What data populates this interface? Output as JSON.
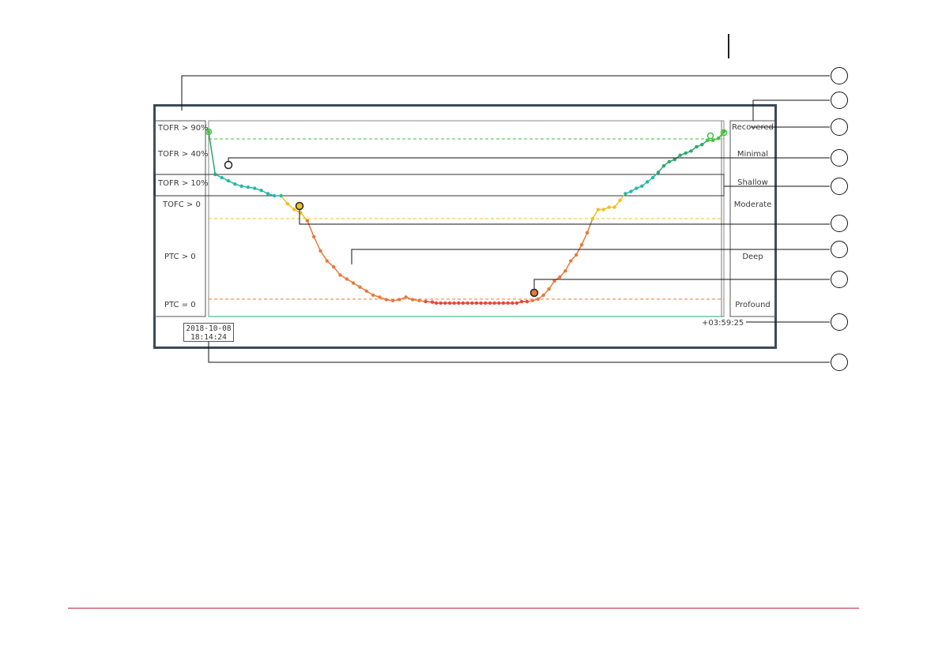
{
  "left_labels": [
    "TOFR > 90%",
    "TOFR > 40%",
    "TOFR > 10%",
    "TOFC > 0",
    "PTC > 0",
    "PTC = 0"
  ],
  "right_labels": [
    "Recovered",
    "Minimal",
    "Shallow",
    "Moderate",
    "Deep",
    "Profound"
  ],
  "timestamp": {
    "date": "2018-10-08",
    "time": "18:14:24"
  },
  "elapsed": "+03:59:25",
  "callout_count": 10,
  "colors": {
    "frame": "#3b4a57",
    "recovered": "#3fbf3f",
    "minimal": "#2aa86a",
    "shallow": "#26b8a6",
    "moderate": "#f0c020",
    "deep": "#e8793a",
    "profound": "#e8473a",
    "footer_rule": "#c0283c"
  },
  "chart_data": {
    "type": "line",
    "xlabel": "",
    "ylabel": "",
    "x_range": [
      "18:14:24",
      "+03:59:25"
    ],
    "series": [
      {
        "y": [
          100,
          80,
          77,
          74,
          71,
          69,
          68,
          67,
          65,
          62,
          60,
          60,
          53,
          48,
          45,
          39,
          31,
          24,
          19,
          16,
          12,
          10,
          8,
          6,
          4,
          2,
          1,
          -1,
          -3,
          -1,
          1,
          -1,
          -3,
          -5,
          -6
        ]
      },
      {
        "y": [
          -8,
          -8,
          -8,
          -8,
          -8,
          -8,
          -8,
          -8,
          -8,
          -8,
          -8,
          -8,
          -8,
          -8,
          -8,
          -8,
          -8,
          -8,
          -8
        ]
      },
      {
        "y": [
          -5,
          -5,
          -3,
          0,
          2,
          5,
          9,
          11,
          14,
          19,
          22,
          27,
          33,
          40,
          48,
          48,
          50,
          50,
          56,
          62,
          64,
          67,
          69,
          73,
          77,
          81,
          84,
          86,
          87,
          89,
          90,
          91,
          93,
          94,
          96,
          96,
          97,
          100
        ]
      }
    ]
  }
}
